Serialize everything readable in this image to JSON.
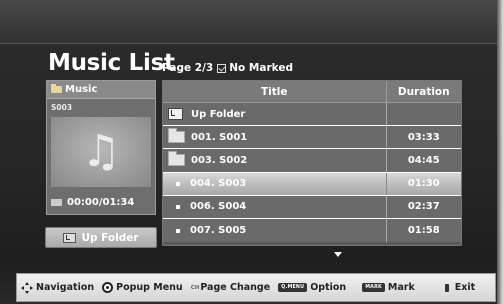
{
  "page": {
    "title": "Music List",
    "page_label": "Page 2/3",
    "marked_label": "No Marked"
  },
  "preview": {
    "header": "Music",
    "item_name": "S003",
    "time": "00:00/01:34",
    "icon": "music-note-icon"
  },
  "up_folder_button": "Up Folder",
  "table": {
    "headers": {
      "title": "Title",
      "duration": "Duration"
    },
    "rows": [
      {
        "title": "Up Folder",
        "duration": "",
        "kind": "up"
      },
      {
        "title": "001.  S001",
        "duration": "03:33",
        "kind": "folder"
      },
      {
        "title": "003.  S002",
        "duration": "04:45",
        "kind": "folder"
      },
      {
        "title": "004.  S003",
        "duration": "01:30",
        "kind": "file",
        "selected": true
      },
      {
        "title": "006.  S004",
        "duration": "02:37",
        "kind": "file"
      },
      {
        "title": "007.  S005",
        "duration": "01:58",
        "kind": "file"
      }
    ]
  },
  "hints": {
    "navigation": "Navigation",
    "popup_menu": "Popup Menu",
    "ch_key": "CH",
    "page_change": "Page Change",
    "qmenu_key": "Q.MENU",
    "option": "Option",
    "mark_key": "MARK",
    "mark": "Mark",
    "exit": "Exit"
  },
  "colors": {
    "selected_row": "#c8c8c8",
    "row_bg": "#6a6a6a",
    "header_bg": "#7a7a7a"
  }
}
